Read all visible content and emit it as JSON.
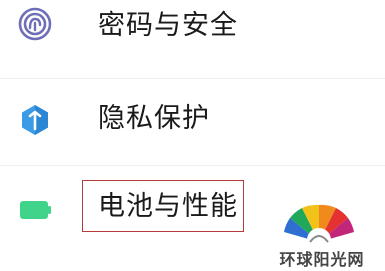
{
  "settings_list": {
    "items": [
      {
        "id": "password",
        "label": "密码与安全",
        "icon": "fingerprint-icon",
        "icon_color": "#6f6fb8"
      },
      {
        "id": "privacy",
        "label": "隐私保护",
        "icon": "privacy-shield-icon",
        "icon_color": "#3c9be6"
      },
      {
        "id": "battery",
        "label": "电池与性能",
        "icon": "battery-icon",
        "icon_color": "#3fd48a",
        "highlighted": true
      }
    ]
  },
  "watermark": {
    "text": "环球阳光网"
  },
  "colors": {
    "highlight_border": "#b53a3a",
    "text": "#1a1a1a"
  }
}
